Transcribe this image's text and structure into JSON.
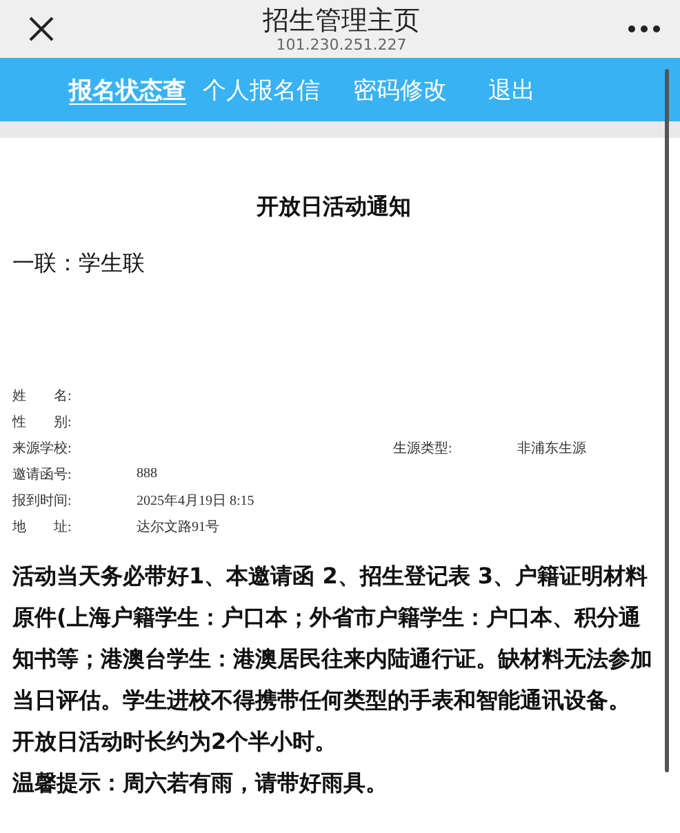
{
  "header": {
    "title": "招生管理主页",
    "address": "101.230.251.227"
  },
  "tabs": [
    {
      "label": "报名状态查",
      "selected": true
    },
    {
      "label": "个人报名信",
      "selected": false
    },
    {
      "label": "密码修改",
      "selected": false
    },
    {
      "label": "退出",
      "selected": false
    }
  ],
  "notice": {
    "title": "开放日活动通知",
    "copy_label": "一联：学生联",
    "fields": [
      {
        "label": "姓　　名:"
      },
      {
        "label": "性　　别:"
      },
      {
        "label": "来源学校:",
        "extra_label": "生源类型:",
        "extra_value": "非浦东生源"
      },
      {
        "label": "邀请函号:",
        "value": "888"
      },
      {
        "label": "报到时间:",
        "value": "2025年4月19日 8:15"
      },
      {
        "label": "地　　址:",
        "value": "达尔文路91号"
      }
    ],
    "paragraphs": [
      "活动当天务必带好1、本邀请函 2、招生登记表 3、户籍证明材料原件(上海户籍学生：户口本；外省市户籍学生：户口本、积分通知书等；港澳台学生：港澳居民往来内陆通行证。缺材料无法参加当日评估。学生进校不得携带任何类型的手表和智能通讯设备。",
      "开放日活动时长约为2个半小时。",
      "温馨提示：周六若有雨，请带好雨具。"
    ]
  }
}
